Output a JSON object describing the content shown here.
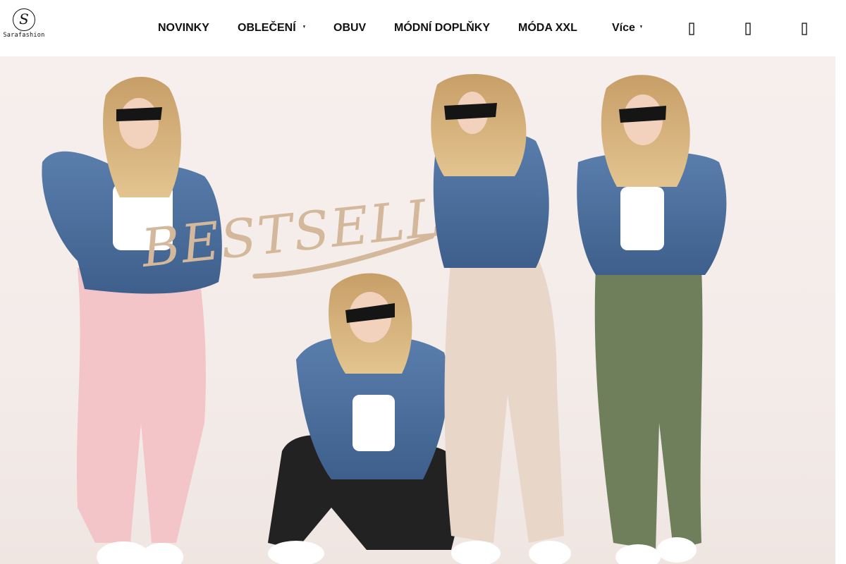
{
  "header": {
    "logo_text": "Sarafashion",
    "nav": [
      {
        "label": "NOVINKY"
      },
      {
        "label": "OBLEČENÍ"
      },
      {
        "label": "OBUV"
      },
      {
        "label": "MÓDNÍ DOPLŇKY"
      },
      {
        "label": "MÓDA XXL"
      }
    ],
    "more_label": "Více",
    "icons": [
      "search-icon",
      "user-icon",
      "cart-icon"
    ]
  },
  "hero": {
    "headline": "BESTSELLER",
    "colors": {
      "background": "#f5ede9",
      "headline": "#d4b89c",
      "denim": "#4b6f9e",
      "pink_pants": "#f3c4c8",
      "beige_pants": "#e8d6c9",
      "green_pants": "#6f7f5c",
      "black_pants": "#222222"
    }
  }
}
